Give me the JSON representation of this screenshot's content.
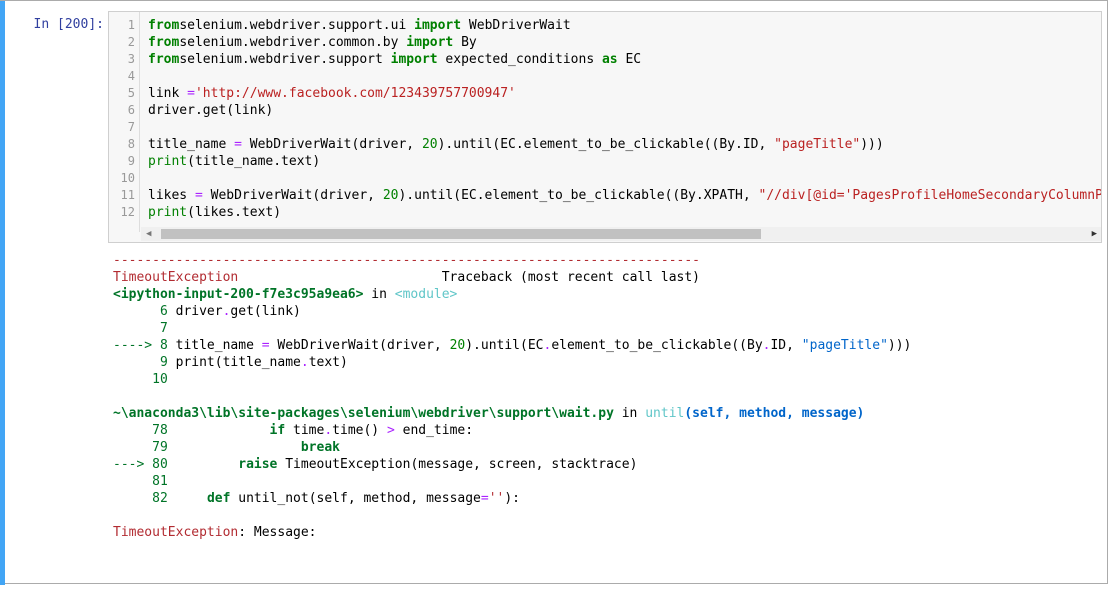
{
  "cell": {
    "prompt": "In [200]:",
    "accent_color": "#42a5f5"
  },
  "code_lines": [
    {
      "n": "1",
      "segs": [
        [
          "kw",
          "from"
        ],
        [
          "",
          "selenium.webdriver.support.ui "
        ],
        [
          "kw",
          "import"
        ],
        [
          "",
          " WebDriverWait"
        ]
      ]
    },
    {
      "n": "2",
      "segs": [
        [
          "kw",
          "from"
        ],
        [
          "",
          "selenium.webdriver.common.by "
        ],
        [
          "kw",
          "import"
        ],
        [
          "",
          " By"
        ]
      ]
    },
    {
      "n": "3",
      "segs": [
        [
          "kw",
          "from"
        ],
        [
          "",
          "selenium.webdriver.support "
        ],
        [
          "kw",
          "import"
        ],
        [
          "",
          " expected_conditions "
        ],
        [
          "kw",
          "as"
        ],
        [
          "",
          " EC"
        ]
      ]
    },
    {
      "n": "4",
      "segs": []
    },
    {
      "n": "5",
      "segs": [
        [
          "",
          "link "
        ],
        [
          "op",
          "="
        ],
        [
          " ",
          ""
        ],
        [
          "str",
          "'http://www.facebook.com/123439757700947'"
        ]
      ]
    },
    {
      "n": "6",
      "segs": [
        [
          "",
          "driver.get(link)"
        ]
      ]
    },
    {
      "n": "7",
      "segs": []
    },
    {
      "n": "8",
      "segs": [
        [
          "",
          "title_name "
        ],
        [
          "op",
          "="
        ],
        [
          "",
          " WebDriverWait(driver, "
        ],
        [
          "num",
          "20"
        ],
        [
          "",
          ").until(EC.element_to_be_clickable((By.ID, "
        ],
        [
          "str",
          "\"pageTitle\""
        ],
        [
          "",
          ")))"
        ]
      ]
    },
    {
      "n": "9",
      "segs": [
        [
          "kw-print",
          "print"
        ],
        [
          "",
          "(title_name.text)"
        ]
      ]
    },
    {
      "n": "10",
      "segs": []
    },
    {
      "n": "11",
      "segs": [
        [
          "",
          "likes "
        ],
        [
          "op",
          "="
        ],
        [
          "",
          " WebDriverWait(driver, "
        ],
        [
          "num",
          "20"
        ],
        [
          "",
          ").until(EC.element_to_be_clickable((By.XPATH, "
        ],
        [
          "str",
          "\"//div[@id='PagesProfileHomeSecondaryColumnPag"
        ]
      ]
    },
    {
      "n": "12",
      "segs": [
        [
          "kw-print",
          "print"
        ],
        [
          "",
          "(likes.text)"
        ]
      ]
    }
  ],
  "output_lines": [
    [
      [
        "dashes",
        "---------------------------------------------------------------------------"
      ]
    ],
    [
      [
        "red",
        "TimeoutException"
      ],
      [
        "",
        "                          Traceback (most recent call last)"
      ]
    ],
    [
      [
        "green-bold",
        "<ipython-input-200-f7e3c95a9ea6>"
      ],
      [
        "",
        " in "
      ],
      [
        "cyan",
        "<module>"
      ]
    ],
    [
      [
        "green",
        "      6"
      ],
      [
        "",
        " driver"
      ],
      [
        "op",
        "."
      ],
      [
        "",
        "get"
      ],
      [
        "",
        "(link)"
      ]
    ],
    [
      [
        "green",
        "      7"
      ]
    ],
    [
      [
        "green",
        "----> 8"
      ],
      [
        "",
        " title_name "
      ],
      [
        "op",
        "="
      ],
      [
        "",
        " WebDriverWait(driver, "
      ],
      [
        "num",
        "20"
      ],
      [
        "",
        ").until(EC"
      ],
      [
        "op",
        "."
      ],
      [
        "",
        "element_to_be_clickable((By"
      ],
      [
        "op",
        "."
      ],
      [
        "",
        "ID, "
      ],
      [
        "blue",
        "\"pageTitle\""
      ],
      [
        "",
        ")))"
      ]
    ],
    [
      [
        "green",
        "      9"
      ],
      [
        "",
        " print(title_name"
      ],
      [
        "op",
        "."
      ],
      [
        "",
        "text)"
      ]
    ],
    [
      [
        "green",
        "     10"
      ]
    ],
    [],
    [
      [
        "green-bold",
        "~\\anaconda3\\lib\\site-packages\\selenium\\webdriver\\support\\wait.py"
      ],
      [
        "",
        " in "
      ],
      [
        "cyan",
        "until"
      ],
      [
        "blue-bold",
        "(self, method, message)"
      ]
    ],
    [
      [
        "green",
        "     78"
      ],
      [
        "",
        "             "
      ],
      [
        "green-bold",
        "if"
      ],
      [
        "",
        " time"
      ],
      [
        "op",
        "."
      ],
      [
        "",
        "time() "
      ],
      [
        "op",
        ">"
      ],
      [
        "",
        " end_time:"
      ]
    ],
    [
      [
        "green",
        "     79"
      ],
      [
        "",
        "                 "
      ],
      [
        "green-bold",
        "break"
      ]
    ],
    [
      [
        "green",
        "---> 80"
      ],
      [
        "",
        "         "
      ],
      [
        "green-bold",
        "raise"
      ],
      [
        "",
        " TimeoutException(message, screen, stacktrace)"
      ]
    ],
    [
      [
        "green",
        "     81"
      ]
    ],
    [
      [
        "green",
        "     82"
      ],
      [
        "",
        "     "
      ],
      [
        "green-bold",
        "def"
      ],
      [
        "",
        " until_not(self, method, message"
      ],
      [
        "op",
        "="
      ],
      [
        "red",
        "''"
      ],
      [
        "",
        "):"
      ]
    ],
    [],
    [
      [
        "red",
        "TimeoutException"
      ],
      [
        "",
        ": Message:"
      ]
    ]
  ]
}
